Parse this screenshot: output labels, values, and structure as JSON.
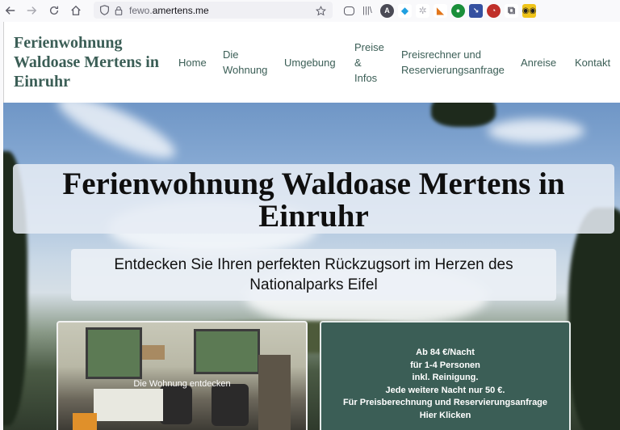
{
  "browser": {
    "url_host_dim": "fewo.",
    "url_host_main": "amertens.me",
    "icons": [
      "back-arrow-icon",
      "forward-arrow-icon",
      "reload-icon",
      "home-icon",
      "shield-icon",
      "lock-icon",
      "star-icon",
      "pocket-icon",
      "library-icon",
      "extension-icons",
      "puzzle-icon"
    ]
  },
  "site": {
    "brand": "Ferienwohnung Waldoase Mertens in Einruhr",
    "menu": [
      {
        "label": "Home"
      },
      {
        "label": "Die Wohnung"
      },
      {
        "label": "Umgebung"
      },
      {
        "label": "Preise & Infos"
      },
      {
        "label": "Preisrechner und Reservierungsanfrage"
      },
      {
        "label": "Anreise"
      },
      {
        "label": "Kontakt"
      }
    ],
    "accent_color": "#3b5e56"
  },
  "hero": {
    "title": "Ferienwohnung Waldoase Mertens in Einruhr",
    "subtitle": "Entdecken Sie Ihren perfekten Rückzugsort im Herzen des Nationalparks Eifel"
  },
  "cards": {
    "photo_label": "Die Wohnung entdecken",
    "price_lines": [
      "Ab 84 €/Nacht",
      "für 1-4 Personen",
      "inkl. Reinigung.",
      "Jede weitere Nacht nur 50 €.",
      "Für Preisberechnung und Reservierungsanfrage",
      "Hier Klicken"
    ]
  }
}
